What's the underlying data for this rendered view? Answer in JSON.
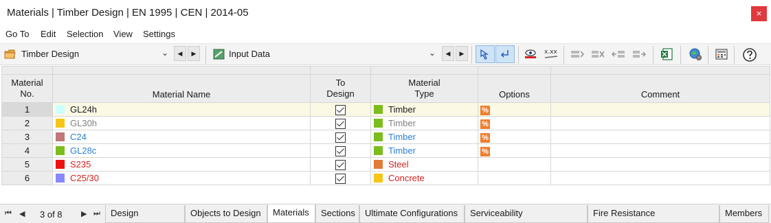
{
  "window": {
    "title": "Materials | Timber Design | EN 1995 | CEN | 2014-05",
    "close_label": "×"
  },
  "menu": [
    {
      "label": "Go To"
    },
    {
      "label": "Edit"
    },
    {
      "label": "Selection"
    },
    {
      "label": "View"
    },
    {
      "label": "Settings"
    }
  ],
  "toolbar": {
    "module_combo": {
      "value": "Timber Design"
    },
    "table_combo": {
      "value": "Input Data"
    },
    "decimal_icon_text": "x.xx"
  },
  "table": {
    "headers": {
      "material_no": [
        "Material",
        "No."
      ],
      "material_name": "Material Name",
      "to_design": [
        "To",
        "Design"
      ],
      "material_type": [
        "Material",
        "Type"
      ],
      "options": "Options",
      "comment": "Comment"
    },
    "rows": [
      {
        "no": "1",
        "name": "GL24h",
        "swatch": "#ccffff",
        "name_color": "#1a1a1a",
        "to_design": true,
        "type": "Timber",
        "type_swatch": "#7cbd1e",
        "type_color": "#1a1a1a",
        "option": "%",
        "comment": ""
      },
      {
        "no": "2",
        "name": "GL30h",
        "swatch": "#f5c518",
        "name_color": "#808080",
        "to_design": true,
        "type": "Timber",
        "type_swatch": "#7cbd1e",
        "type_color": "#808080",
        "option": "%",
        "comment": ""
      },
      {
        "no": "3",
        "name": "C24",
        "swatch": "#c07878",
        "name_color": "#2b7fd6",
        "to_design": true,
        "type": "Timber",
        "type_swatch": "#7cbd1e",
        "type_color": "#2b7fd6",
        "option": "%",
        "comment": ""
      },
      {
        "no": "4",
        "name": "GL28c",
        "swatch": "#7cbd1e",
        "name_color": "#2b7fd6",
        "to_design": true,
        "type": "Timber",
        "type_swatch": "#7cbd1e",
        "type_color": "#2b7fd6",
        "option": "%",
        "comment": ""
      },
      {
        "no": "5",
        "name": "S235",
        "swatch": "#ee1111",
        "name_color": "#d42020",
        "to_design": true,
        "type": "Steel",
        "type_swatch": "#e07b39",
        "type_color": "#d42020",
        "option": "",
        "comment": ""
      },
      {
        "no": "6",
        "name": "C25/30",
        "swatch": "#8888ff",
        "name_color": "#d42020",
        "to_design": true,
        "type": "Concrete",
        "type_swatch": "#f5c518",
        "type_color": "#d42020",
        "option": "",
        "comment": ""
      }
    ]
  },
  "tabs": {
    "page_count": "3 of 8",
    "items": [
      {
        "label": "Design Situations"
      },
      {
        "label": "Objects to Design"
      },
      {
        "label": "Materials"
      },
      {
        "label": "Sections"
      },
      {
        "label": "Ultimate Configurations"
      },
      {
        "label": "Serviceability Configurations"
      },
      {
        "label": "Fire Resistance Configurations"
      },
      {
        "label": "Members"
      }
    ],
    "active_index": 2
  },
  "colors": {
    "accent_close": "#e0393e",
    "selected_row": "#fbf9e4",
    "header_bg": "#ececec",
    "active_tool": "#cfe3f7"
  }
}
